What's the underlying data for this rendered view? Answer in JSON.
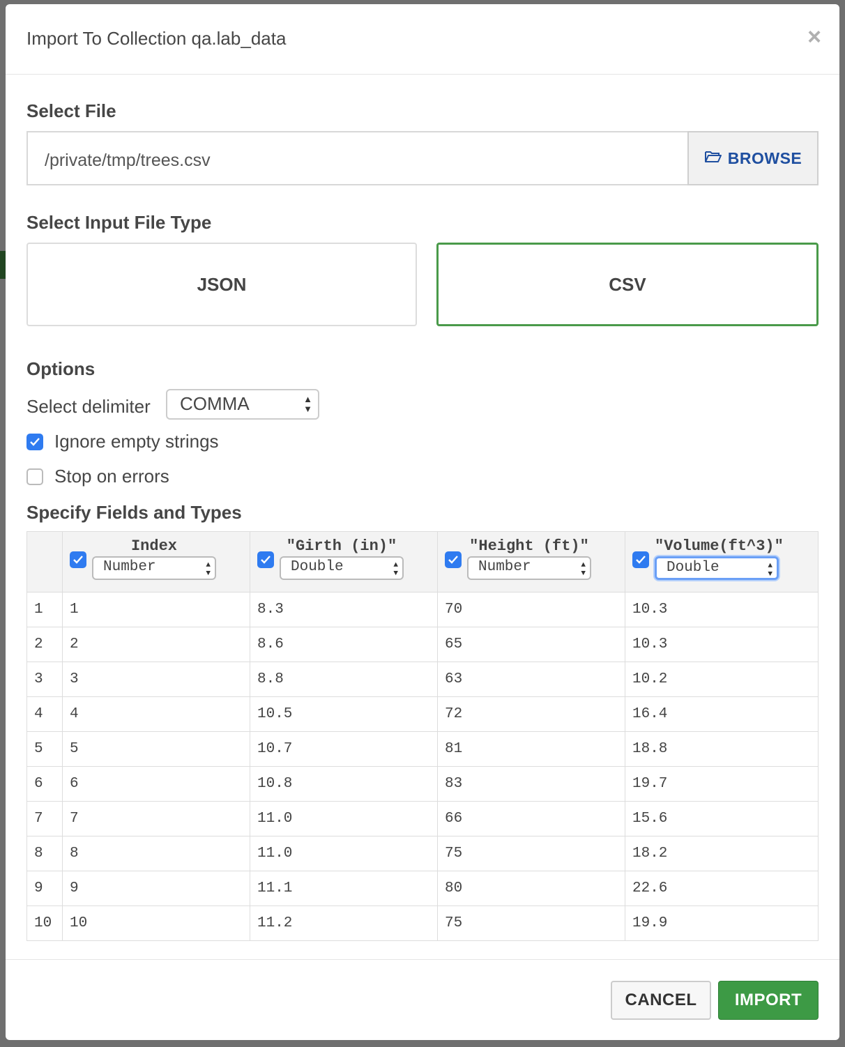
{
  "dialog": {
    "title": "Import To Collection qa.lab_data",
    "close_symbol": "×"
  },
  "select_file": {
    "label": "Select File",
    "path": "/private/tmp/trees.csv",
    "browse_label": "BROWSE"
  },
  "file_type": {
    "label": "Select Input File Type",
    "options": [
      "JSON",
      "CSV"
    ],
    "selected": "CSV"
  },
  "options": {
    "label": "Options",
    "delimiter_label": "Select delimiter",
    "delimiter_value": "COMMA",
    "ignore_empty_label": "Ignore empty strings",
    "ignore_empty_checked": true,
    "stop_on_errors_label": "Stop on errors",
    "stop_on_errors_checked": false
  },
  "fields": {
    "label": "Specify Fields and Types",
    "columns": [
      {
        "name": "Index",
        "type": "Number",
        "checked": true
      },
      {
        "name": "\"Girth (in)\"",
        "type": "Double",
        "checked": true
      },
      {
        "name": "\"Height (ft)\"",
        "type": "Number",
        "checked": true
      },
      {
        "name": "\"Volume(ft^3)\"",
        "type": "Double",
        "checked": true
      }
    ],
    "rows": [
      [
        "1",
        "1",
        "8.3",
        "70",
        "10.3"
      ],
      [
        "2",
        "2",
        "8.6",
        "65",
        "10.3"
      ],
      [
        "3",
        "3",
        "8.8",
        "63",
        "10.2"
      ],
      [
        "4",
        "4",
        "10.5",
        "72",
        "16.4"
      ],
      [
        "5",
        "5",
        "10.7",
        "81",
        "18.8"
      ],
      [
        "6",
        "6",
        "10.8",
        "83",
        "19.7"
      ],
      [
        "7",
        "7",
        "11.0",
        "66",
        "15.6"
      ],
      [
        "8",
        "8",
        "11.0",
        "75",
        "18.2"
      ],
      [
        "9",
        "9",
        "11.1",
        "80",
        "22.6"
      ],
      [
        "10",
        "10",
        "11.2",
        "75",
        "19.9"
      ]
    ]
  },
  "footer": {
    "cancel_label": "CANCEL",
    "import_label": "IMPORT"
  },
  "colors": {
    "accent_green": "#3d9a45",
    "checkbox_blue": "#2f7bf0",
    "browse_blue": "#1f4fa0"
  }
}
